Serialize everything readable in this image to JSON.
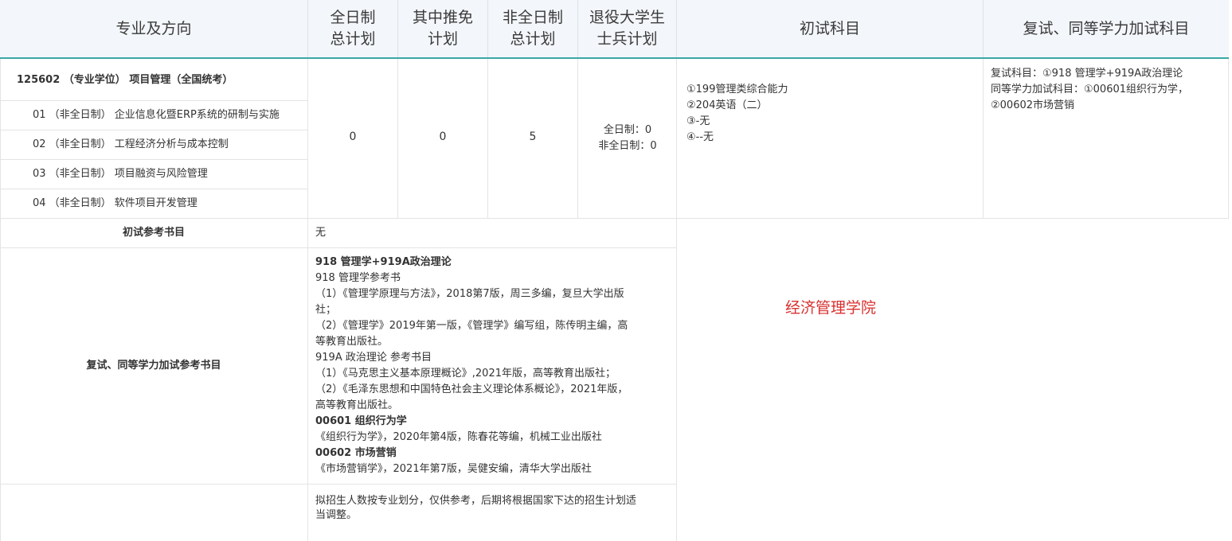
{
  "header": {
    "major": "专业及方向",
    "fulltime_1": "全日制",
    "fulltime_2": "总计划",
    "exempt_1": "其中推免",
    "exempt_2": "计划",
    "parttime_1": "非全日制",
    "parttime_2": "总计划",
    "soldier_1": "退役大学生",
    "soldier_2": "士兵计划",
    "initial_subjects": "初试科目",
    "retest_subjects": "复试、同等学力加试科目"
  },
  "program": {
    "title": "125602 （专业学位） 项目管理（全国统考）",
    "directions": [
      "01 （非全日制） 企业信息化暨ERP系统的研制与实施",
      "02 （非全日制） 工程经济分析与成本控制",
      "03 （非全日制） 项目融资与风险管理",
      "04 （非全日制） 软件项目开发管理"
    ],
    "fulltime_total": "0",
    "exempt": "0",
    "parttime_total": "5",
    "soldier_fulltime": "全日制：0",
    "soldier_parttime": "非全日制：0",
    "initial_subjects": [
      "①199管理类综合能力",
      "②204英语（二）",
      "③-无",
      "④--无"
    ],
    "retest_lines": [
      "复试科目：①918 管理学+919A政治理论",
      "同等学力加试科目：①00601组织行为学，",
      "②00602市场营销"
    ]
  },
  "refs": {
    "initial_label": "初试参考书目",
    "initial_value": "无",
    "retest_label": "复试、同等学力加试参考书目",
    "retest_lines": [
      {
        "t": "918 管理学+919A政治理论",
        "b": true
      },
      {
        "t": "918 管理学参考书",
        "b": false
      },
      {
        "t": "（1）《管理学原理与方法》，2018第7版，周三多编，复旦大学出版",
        "b": false
      },
      {
        "t": "社；",
        "b": false
      },
      {
        "t": "（2）《管理学》2019年第一版，《管理学》编写组，陈传明主编，高",
        "b": false
      },
      {
        "t": "等教育出版社。",
        "b": false
      },
      {
        "t": "919A 政治理论 参考书目",
        "b": false
      },
      {
        "t": "（1）《马克思主义基本原理概论》,2021年版，高等教育出版社；",
        "b": false
      },
      {
        "t": "（2）《毛泽东思想和中国特色社会主义理论体系概论》，2021年版，",
        "b": false
      },
      {
        "t": "高等教育出版社。",
        "b": false
      },
      {
        "t": "00601 组织行为学",
        "b": true
      },
      {
        "t": "《组织行为学》，2020年第4版，陈春花等编，机械工业出版社",
        "b": false
      },
      {
        "t": "00602 市场营销",
        "b": true
      },
      {
        "t": "《市场营销学》，2021年第7版，吴健安编，清华大学出版社",
        "b": false
      }
    ],
    "note_lines": [
      "拟招生人数按专业划分，仅供参考，后期将根据国家下达的招生计划适",
      "当调整。"
    ],
    "college": "经济管理学院"
  }
}
